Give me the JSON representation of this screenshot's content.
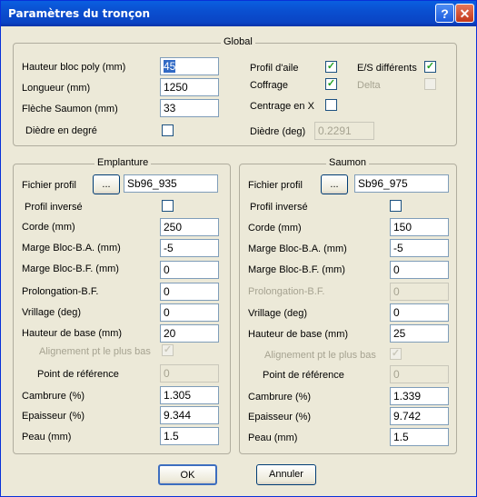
{
  "window": {
    "title": "Paramètres du tronçon"
  },
  "global": {
    "group_title": "Global",
    "hauteur_label": "Hauteur bloc poly (mm)",
    "hauteur_value": "45",
    "longueur_label": "Longueur (mm)",
    "longueur_value": "1250",
    "fleche_label": "Flèche Saumon (mm)",
    "fleche_value": "33",
    "diedre_degre_label": "Dièdre en degré",
    "profil_aile_label": "Profil d'aile",
    "coffrage_label": "Coffrage",
    "centrage_label": "Centrage en X",
    "es_label": "E/S différents",
    "delta_label": "Delta",
    "diedre_deg_label": "Dièdre (deg)",
    "diedre_deg_value": "0.2291"
  },
  "emplanture": {
    "group_title": "Emplanture",
    "fichier_label": "Fichier profil",
    "browse_label": "...",
    "fichier_value": "Sb96_935",
    "inverse_label": "Profil inversé",
    "corde_label": "Corde  (mm)",
    "corde_value": "250",
    "marge_ba_label": "Marge Bloc-B.A. (mm)",
    "marge_ba_value": "-5",
    "marge_bf_label": "Marge Bloc-B.F. (mm)",
    "marge_bf_value": "0",
    "prolongation_label": "Prolongation-B.F.",
    "prolongation_value": "0",
    "vrillage_label": "Vrillage (deg)",
    "vrillage_value": "0",
    "hauteur_base_label": "Hauteur de base (mm)",
    "hauteur_base_value": "20",
    "alignement_label": "Alignement pt le plus bas",
    "point_ref_label": "Point de référence",
    "point_ref_value": "0",
    "cambrure_label": "Cambrure (%)",
    "cambrure_value": "1.305",
    "epaisseur_label": "Epaisseur (%)",
    "epaisseur_value": "9.344",
    "peau_label": "Peau (mm)",
    "peau_value": "1.5"
  },
  "saumon": {
    "group_title": "Saumon",
    "fichier_label": "Fichier profil",
    "browse_label": "...",
    "fichier_value": "Sb96_975",
    "inverse_label": "Profil inversé",
    "corde_label": "Corde (mm)",
    "corde_value": "150",
    "marge_ba_label": "Marge Bloc-B.A. (mm)",
    "marge_ba_value": "-5",
    "marge_bf_label": "Marge Bloc-B.F. (mm)",
    "marge_bf_value": "0",
    "prolongation_label": "Prolongation-B.F.",
    "prolongation_value": "0",
    "vrillage_label": "Vrillage (deg)",
    "vrillage_value": "0",
    "hauteur_base_label": "Hauteur de base (mm)",
    "hauteur_base_value": "25",
    "alignement_label": "Alignement pt le plus bas",
    "point_ref_label": "Point de référence",
    "point_ref_value": "0",
    "cambrure_label": "Cambrure (%)",
    "cambrure_value": "1.339",
    "epaisseur_label": "Epaisseur (%)",
    "epaisseur_value": "9.742",
    "peau_label": "Peau (mm)",
    "peau_value": "1.5"
  },
  "buttons": {
    "ok_label": "OK",
    "cancel_label": "Annuler"
  },
  "titlebar": {
    "help_glyph": "?",
    "close_glyph": "✕"
  },
  "check_glyph": "✓"
}
